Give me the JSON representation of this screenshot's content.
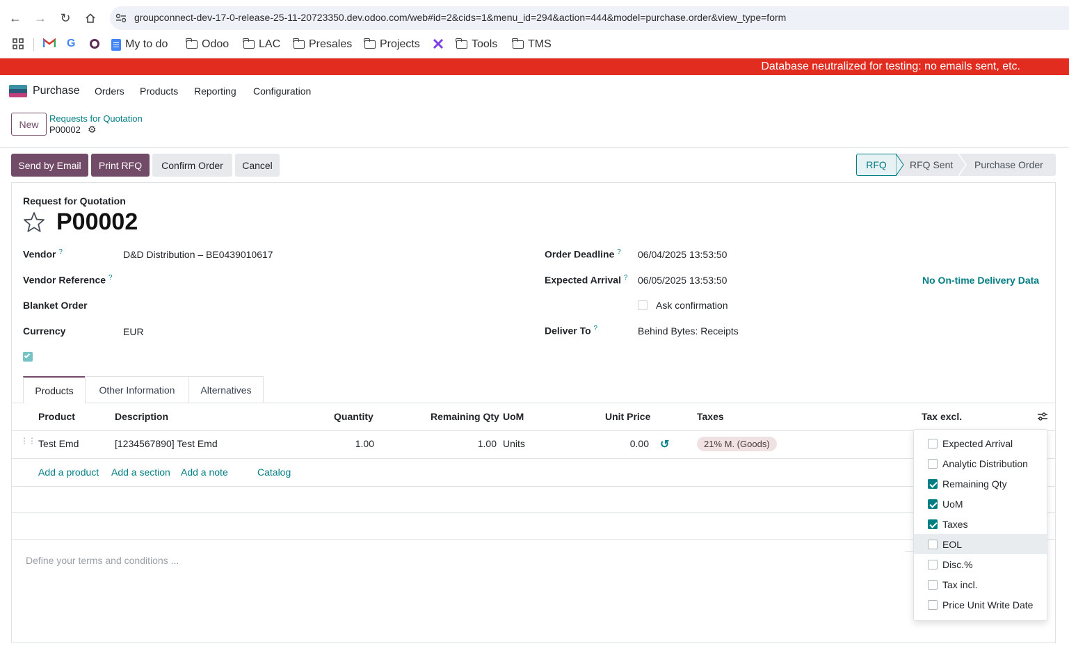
{
  "browser": {
    "url": "groupconnect-dev-17-0-release-25-11-20723350.dev.odoo.com/web#id=2&cids=1&menu_id=294&action=444&model=purchase.order&view_type=form",
    "bookmarks": [
      "My to do",
      "Odoo",
      "LAC",
      "Presales",
      "Projects",
      "Tools",
      "TMS"
    ]
  },
  "banner": {
    "text": "Database neutralized for testing: no emails sent, etc.",
    "color": "#e22c1f"
  },
  "navbar": {
    "app_name": "Purchase",
    "menus": [
      "Orders",
      "Products",
      "Reporting",
      "Configuration"
    ]
  },
  "control_panel": {
    "new_label": "New",
    "breadcrumb": "Requests for Quotation",
    "record_name": "P00002"
  },
  "actions": {
    "send_email": "Send by Email",
    "print_rfq": "Print RFQ",
    "confirm": "Confirm Order",
    "cancel": "Cancel"
  },
  "statusbar": {
    "steps": [
      "RFQ",
      "RFQ Sent",
      "Purchase Order"
    ],
    "active": "RFQ"
  },
  "form": {
    "subtitle": "Request for Quotation",
    "title": "P00002",
    "vendor_label": "Vendor",
    "vendor_value": "D&D Distribution – BE0439010617",
    "vendor_ref_label": "Vendor Reference",
    "blanket_label": "Blanket Order",
    "currency_label": "Currency",
    "currency_value": "EUR",
    "deadline_label": "Order Deadline",
    "deadline_value": "06/04/2025 13:53:50",
    "arrival_label": "Expected Arrival",
    "arrival_value": "06/05/2025 13:53:50",
    "ontime_text": "No On-time Delivery Data",
    "ask_confirm_label": "Ask confirmation",
    "deliver_label": "Deliver To",
    "deliver_value": "Behind Bytes: Receipts",
    "help_mark": "?"
  },
  "tabs": [
    "Products",
    "Other Information",
    "Alternatives"
  ],
  "lines": {
    "headers": {
      "product": "Product",
      "description": "Description",
      "quantity": "Quantity",
      "remaining": "Remaining Qty",
      "uom": "UoM",
      "price": "Unit Price",
      "taxes": "Taxes",
      "subtotal": "Tax excl."
    },
    "rows": [
      {
        "product": "Test Emd",
        "description": "[1234567890] Test Emd",
        "quantity": "1.00",
        "remaining": "1.00",
        "uom": "Units",
        "price": "0.00",
        "tax": "21% M. (Goods)"
      }
    ],
    "add_product": "Add a product",
    "add_section": "Add a section",
    "add_note": "Add a note",
    "catalog": "Catalog"
  },
  "terms_placeholder": "Define your terms and conditions ...",
  "column_options": [
    {
      "label": "Expected Arrival",
      "checked": false
    },
    {
      "label": "Analytic Distribution",
      "checked": false
    },
    {
      "label": "Remaining Qty",
      "checked": true
    },
    {
      "label": "UoM",
      "checked": true
    },
    {
      "label": "Taxes",
      "checked": true
    },
    {
      "label": "EOL",
      "checked": false
    },
    {
      "label": "Disc.%",
      "checked": false
    },
    {
      "label": "Tax incl.",
      "checked": false
    },
    {
      "label": "Price Unit Write Date",
      "checked": false
    }
  ],
  "colors": {
    "primary": "#714b67",
    "accent": "#017e84"
  }
}
